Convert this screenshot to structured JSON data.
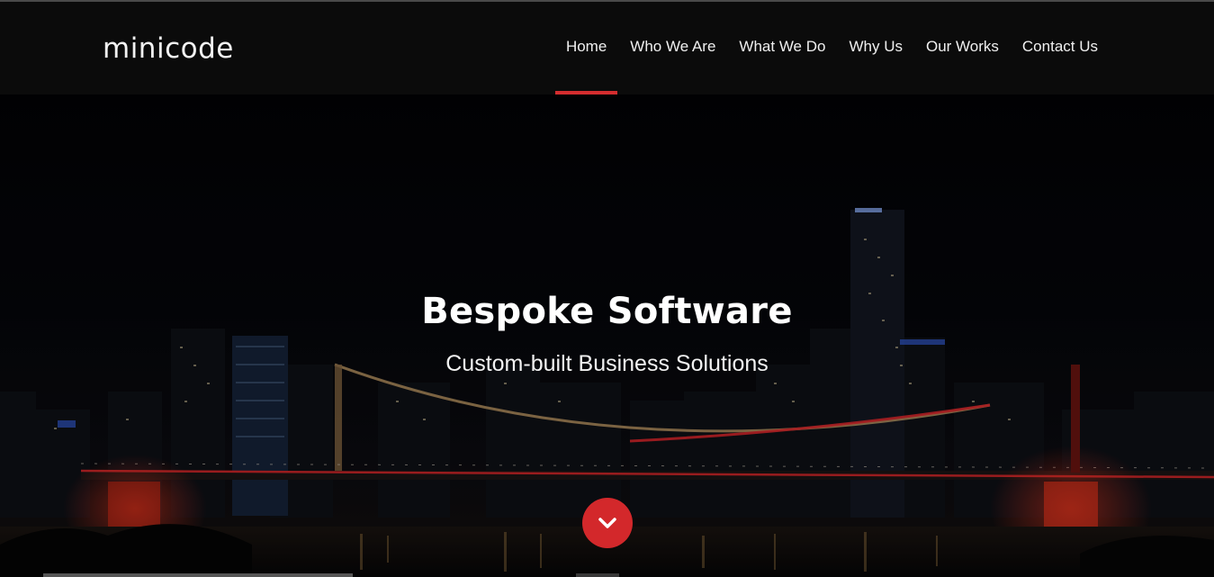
{
  "brand": {
    "logo_text": "minicode"
  },
  "nav": {
    "items": [
      {
        "label": "Home",
        "active": true
      },
      {
        "label": "Who We Are",
        "active": false
      },
      {
        "label": "What We Do",
        "active": false
      },
      {
        "label": "Why Us",
        "active": false
      },
      {
        "label": "Our Works",
        "active": false
      },
      {
        "label": "Contact Us",
        "active": false
      }
    ]
  },
  "hero": {
    "title": "Bespoke Software",
    "subtitle": "Custom-built Business Solutions",
    "scroll_icon": "chevron-down-icon",
    "background": "night-city-bridge-skyline"
  },
  "colors": {
    "accent": "#d42d2f",
    "header_bg": "#0b0b0b",
    "text": "#ffffff"
  }
}
